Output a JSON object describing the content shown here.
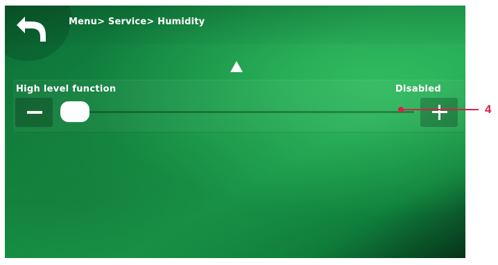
{
  "header": {
    "breadcrumb": "Menu> Service> Humidity",
    "back_icon": "back-arrow-icon"
  },
  "navigation": {
    "scroll_up_icon": "up-triangle-icon"
  },
  "setting": {
    "label": "High level function",
    "value": "Disabled",
    "slider_position": 0,
    "decrease_icon": "minus-icon",
    "increase_icon": "plus-icon"
  },
  "annotation": {
    "number": "4",
    "color": "#d71f4b"
  },
  "colors": {
    "background_green": "#16994a",
    "text": "#ffffff"
  }
}
